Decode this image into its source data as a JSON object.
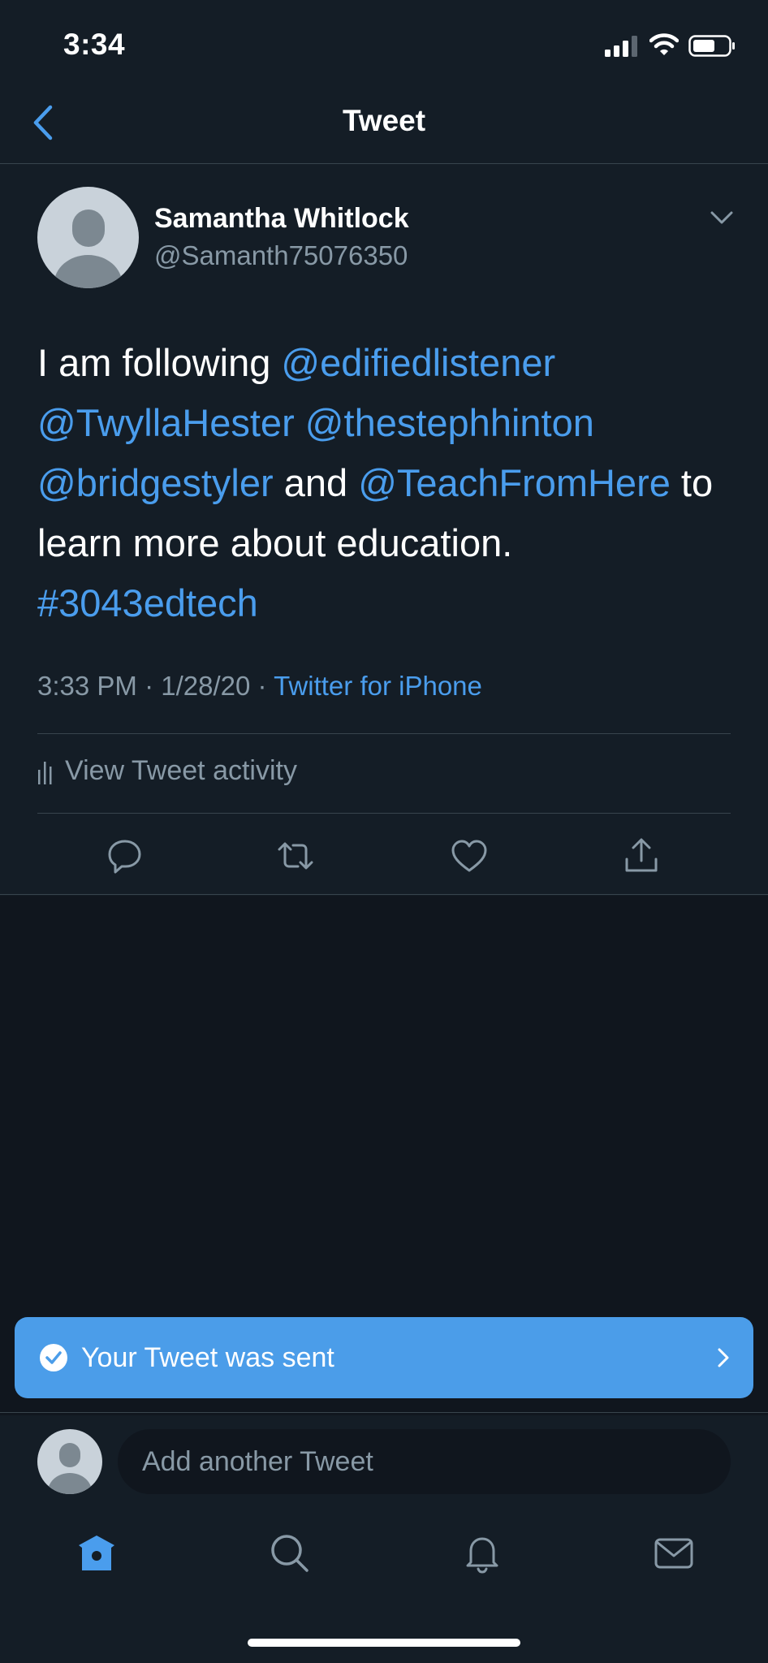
{
  "status_bar": {
    "time": "3:34"
  },
  "header": {
    "title": "Tweet"
  },
  "tweet": {
    "author_name": "Samantha Whitlock",
    "author_handle": "@Samanth75076350",
    "text_parts": [
      {
        "text": "I am following ",
        "link": false
      },
      {
        "text": "@edifiedlistener",
        "link": true
      },
      {
        "text": " ",
        "link": false
      },
      {
        "text": "@TwyllaHester",
        "link": true
      },
      {
        "text": " ",
        "link": false
      },
      {
        "text": "@thestephhinton",
        "link": true
      },
      {
        "text": " ",
        "link": false
      },
      {
        "text": "@bridgestyler",
        "link": true
      },
      {
        "text": " and ",
        "link": false
      },
      {
        "text": "@TeachFromHere",
        "link": true
      },
      {
        "text": " to learn more about education. ",
        "link": false
      },
      {
        "text": "#3043edtech",
        "link": true
      }
    ],
    "time": "3:33 PM",
    "date": "1/28/20",
    "source": "Twitter for iPhone",
    "activity_label": "View Tweet activity"
  },
  "toast": {
    "message": "Your Tweet was sent"
  },
  "composer": {
    "placeholder": "Add another Tweet"
  },
  "colors": {
    "accent": "#4a9ded",
    "background": "#141d26",
    "muted": "#8899a6",
    "toast": "#4b9de9"
  },
  "tabs": [
    "home-icon",
    "search-icon",
    "bell-icon",
    "mail-icon"
  ]
}
